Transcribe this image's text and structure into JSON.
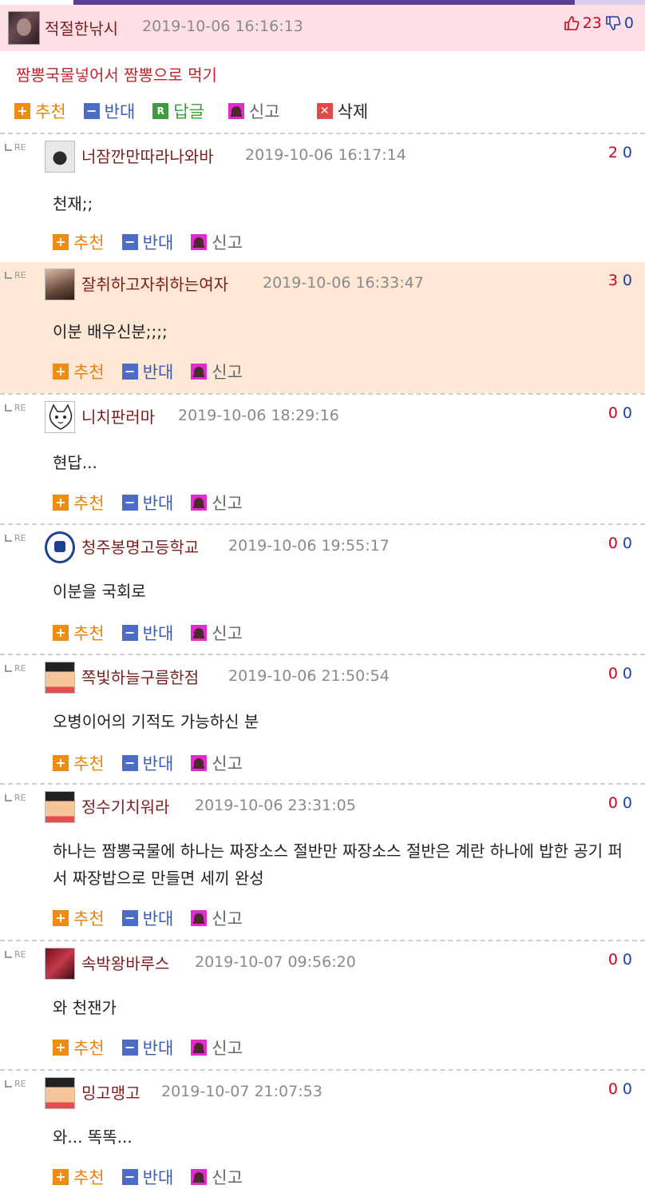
{
  "post": {
    "nickname": "적절한낚시",
    "date": "2019-10-06 16:16:13",
    "up_votes": "23",
    "down_votes": "0",
    "content": "짬뽕국물넣어서 짬뽕으로 먹기",
    "actions": {
      "recommend": "추천",
      "oppose": "반대",
      "reply": "답글",
      "report": "신고",
      "delete": "삭제"
    }
  },
  "re_label": "RE",
  "reply_actions": {
    "recommend": "추천",
    "oppose": "반대",
    "report": "신고"
  },
  "replies": [
    {
      "nickname": "너잠깐만따라나와바",
      "date": "2019-10-06 16:17:14",
      "up": "2",
      "down": "0",
      "text": "천재;;"
    },
    {
      "nickname": "잘취하고자취하는여자",
      "date": "2019-10-06 16:33:47",
      "up": "3",
      "down": "0",
      "text": "이분 배우신분;;;;"
    },
    {
      "nickname": "니치판러마",
      "date": "2019-10-06 18:29:16",
      "up": "0",
      "down": "0",
      "text": "현답..."
    },
    {
      "nickname": "청주봉명고등학교",
      "date": "2019-10-06 19:55:17",
      "up": "0",
      "down": "0",
      "text": "이분을 국회로"
    },
    {
      "nickname": "쪽빛하늘구름한점",
      "date": "2019-10-06 21:50:54",
      "up": "0",
      "down": "0",
      "text": "오병이어의 기적도 가능하신 분"
    },
    {
      "nickname": "정수기치워라",
      "date": "2019-10-06 23:31:05",
      "up": "0",
      "down": "0",
      "text": "하나는 짬뽕국물에 하나는 짜장소스 절반만 짜장소스 절반은 계란 하나에 밥한 공기 퍼서 짜장밥으로 만들면 세끼 완성"
    },
    {
      "nickname": "속박왕바루스",
      "date": "2019-10-07 09:56:20",
      "up": "0",
      "down": "0",
      "text": "와 천잰가"
    },
    {
      "nickname": "밍고맹고",
      "date": "2019-10-07 21:07:53",
      "up": "0",
      "down": "0",
      "text": "와... 똑똑..."
    }
  ]
}
